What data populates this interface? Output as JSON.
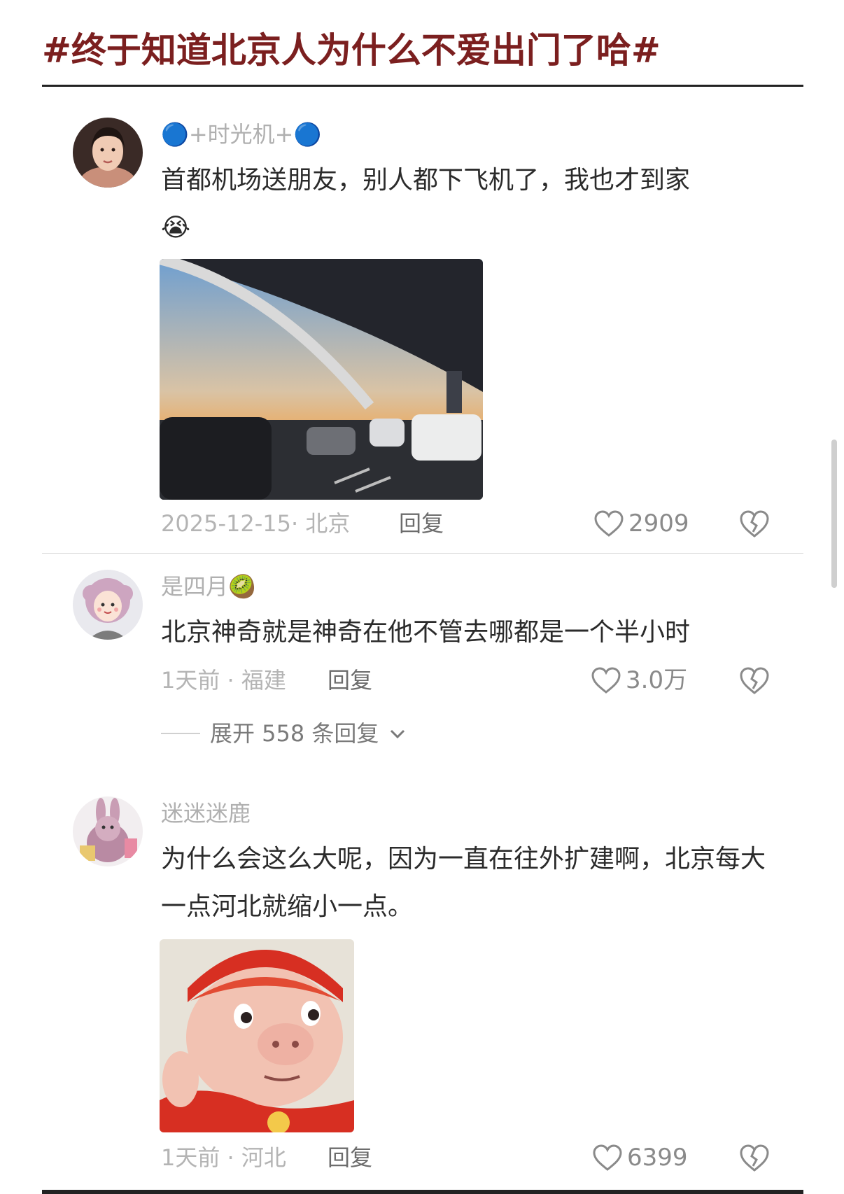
{
  "page": {
    "title": "#终于知道北京人为什么不爱出门了哈#"
  },
  "comments": [
    {
      "username": "🔵+时光机+🔵",
      "text": "首都机场送朋友，别人都下飞机了，我也才到家",
      "emoji": "😭",
      "date_location": "2025-12-15· 北京",
      "reply_label": "回复",
      "likes": "2909"
    },
    {
      "username": "是四月🥝",
      "text": "北京神奇就是神奇在他不管去哪都是一个半小时",
      "date_location": "1天前 · 福建",
      "reply_label": "回复",
      "likes": "3.0万",
      "expand_label": "展开 558 条回复"
    },
    {
      "username": "迷迷迷鹿",
      "text": "为什么会这么大呢，因为一直在往外扩建啊，北京每大一点河北就缩小一点。",
      "date_location": "1天前 · 河北",
      "reply_label": "回复",
      "likes": "6399"
    }
  ],
  "icons": {
    "like": "heart-outline-icon",
    "dislike": "broken-heart-icon",
    "expand": "chevron-down-icon"
  },
  "colors": {
    "title": "#7b1f1f",
    "meta": "#b4b4b4",
    "text": "#2b2b2b"
  }
}
